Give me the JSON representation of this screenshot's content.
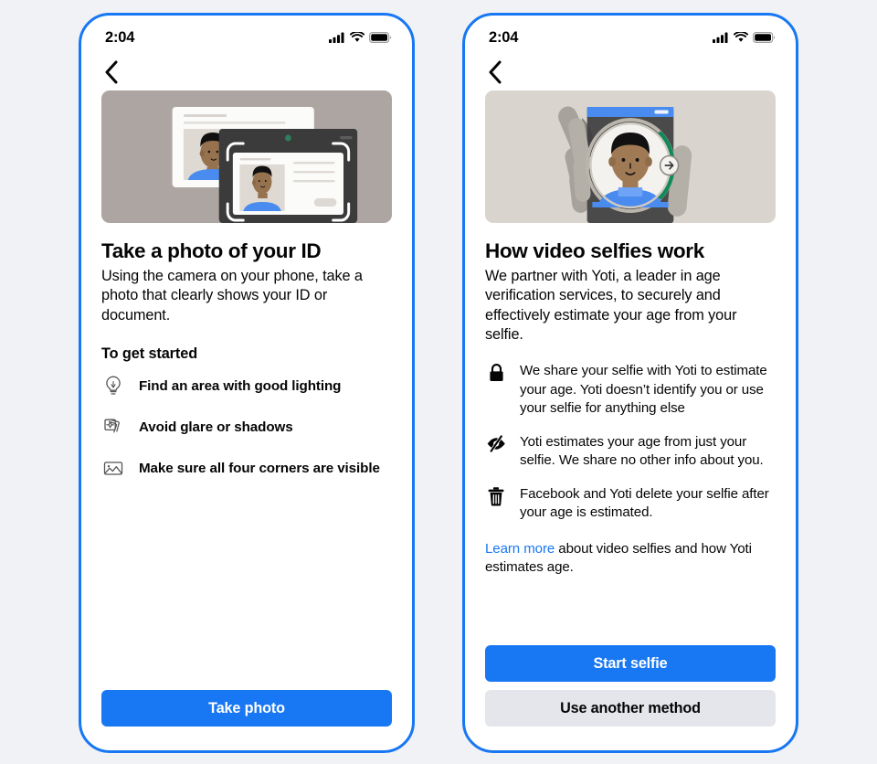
{
  "colors": {
    "page_background": "#f0f2f5",
    "accent_blue": "#1877f2",
    "secondary_button": "#e4e6eb",
    "text": "#050505",
    "hero_left_background": "#ada5a1",
    "hero_right_background": "#d9d5ce",
    "progress_arc_green": "#108a5a"
  },
  "phones": [
    {
      "status_bar": {
        "time": "2:04",
        "icons": [
          "cellular-signal-icon",
          "wifi-icon",
          "battery-icon"
        ]
      },
      "nav": {
        "back_icon": "chevron-left-icon"
      },
      "hero": {
        "illustration": "id-document-camera-capture-illustration"
      },
      "title": "Take a photo of your ID",
      "body": "Using the camera on your phone, take a photo that clearly shows your ID or document.",
      "subhead": "To get started",
      "tips": [
        {
          "icon": "lightbulb-icon",
          "label": "Find an area with good lighting"
        },
        {
          "icon": "glare-cards-icon",
          "label": "Avoid glare or shadows"
        },
        {
          "icon": "photo-frame-icon",
          "label": "Make sure all four corners are visible"
        }
      ],
      "buttons": [
        {
          "label": "Take photo",
          "style": "primary"
        }
      ]
    },
    {
      "status_bar": {
        "time": "2:04",
        "icons": [
          "cellular-signal-icon",
          "wifi-icon",
          "battery-icon"
        ]
      },
      "nav": {
        "back_icon": "chevron-left-icon"
      },
      "hero": {
        "illustration": "hand-holding-phone-video-selfie-illustration"
      },
      "title": "How video selfies work",
      "body": "We partner with Yoti, a leader in age verification services, to securely and effectively estimate your age from your selfie.",
      "infos": [
        {
          "icon": "lock-icon",
          "text": "We share your selfie with Yoti to estimate your age. Yoti doesn’t identify you or use your selfie for anything else"
        },
        {
          "icon": "eye-off-icon",
          "text": "Yoti estimates your age from just your selfie. We share no other info about you."
        },
        {
          "icon": "trash-icon",
          "text": "Facebook and Yoti delete your selfie after your age is estimated."
        }
      ],
      "learn_more": {
        "link_label": "Learn more",
        "rest": " about video selfies and how Yoti estimates age."
      },
      "buttons": [
        {
          "label": "Start selfie",
          "style": "primary"
        },
        {
          "label": "Use another method",
          "style": "secondary"
        }
      ]
    }
  ]
}
